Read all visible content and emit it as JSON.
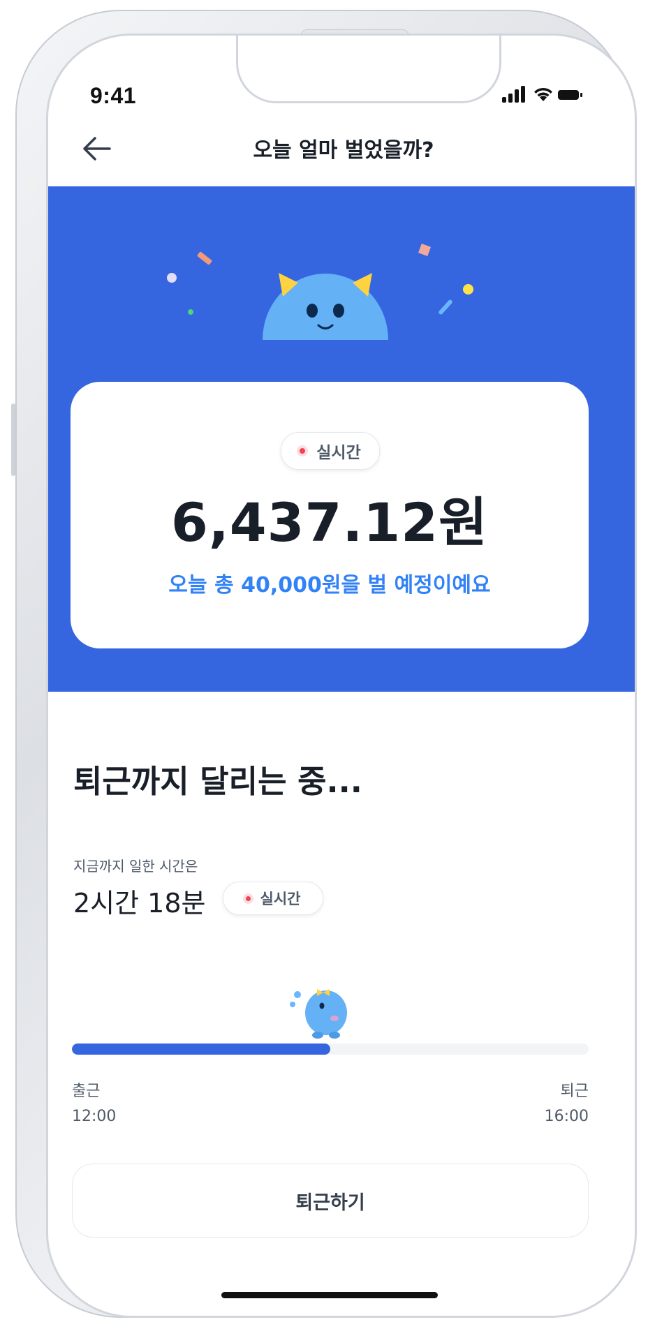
{
  "status_bar": {
    "time": "9:41",
    "signal_icon": "cellular-signal-icon",
    "wifi_icon": "wifi-icon",
    "battery_icon": "battery-icon"
  },
  "header": {
    "back_icon": "arrow-left-icon",
    "title": "오늘 얼마 벌었을까?"
  },
  "hero": {
    "background_color": "#3566e0",
    "mascot": "mascot-icon",
    "realtime_badge": "실시간",
    "amount": "6,437.12원",
    "expected_text": "오늘 총 40,000원을 벌 예정이예요"
  },
  "progress_section": {
    "heading": "퇴근까지 달리는 중...",
    "worked_label": "지금까지 일한 시간은",
    "worked_value": "2시간 18분",
    "realtime_badge": "실시간",
    "progress_fraction": 0.5,
    "start_label": "출근",
    "start_time": "12:00",
    "end_label": "퇴근",
    "end_time": "16:00",
    "end_button_label": "퇴근하기"
  },
  "colors": {
    "accent": "#3566e0",
    "link": "#3182f6",
    "live_dot": "#f04452"
  }
}
